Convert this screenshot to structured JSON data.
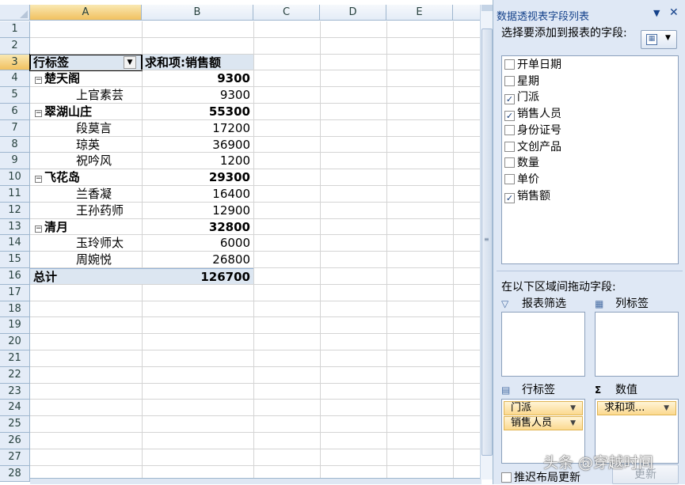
{
  "sheet": {
    "columns": [
      "A",
      "B",
      "C",
      "D",
      "E"
    ],
    "selected_column": "A",
    "rows": [
      "1",
      "2",
      "3",
      "4",
      "5",
      "6",
      "7",
      "8",
      "9",
      "10",
      "11",
      "12",
      "13",
      "14",
      "15",
      "16",
      "17",
      "18",
      "19",
      "20",
      "21",
      "22",
      "23",
      "24",
      "25",
      "26",
      "27",
      "28"
    ],
    "selected_row": "3"
  },
  "pivot": {
    "row_label_header": "行标签",
    "value_header": "求和项:销售额",
    "collapse_glyph": "⊟",
    "groups": [
      {
        "name": "楚天阁",
        "total": "9300",
        "items": [
          {
            "name": "上官素芸",
            "value": "9300"
          }
        ]
      },
      {
        "name": "翠湖山庄",
        "total": "55300",
        "items": [
          {
            "name": "段莫言",
            "value": "17200"
          },
          {
            "name": "琼英",
            "value": "36900"
          },
          {
            "name": "祝吟风",
            "value": "1200"
          }
        ]
      },
      {
        "name": "飞花岛",
        "total": "29300",
        "items": [
          {
            "name": "兰香凝",
            "value": "16400"
          },
          {
            "name": "王孙药师",
            "value": "12900"
          }
        ]
      },
      {
        "name": "清月",
        "total": "32800",
        "items": [
          {
            "name": "玉玲师太",
            "value": "6000"
          },
          {
            "name": "周婉悦",
            "value": "26800"
          }
        ]
      }
    ],
    "grand_total_label": "总计",
    "grand_total": "126700"
  },
  "field_list": {
    "title": "数据透视表字段列表",
    "choose_label": "选择要添加到报表的字段:",
    "fields": [
      {
        "label": "开单日期",
        "checked": false
      },
      {
        "label": "星期",
        "checked": false
      },
      {
        "label": "门派",
        "checked": true
      },
      {
        "label": "销售人员",
        "checked": true
      },
      {
        "label": "身份证号",
        "checked": false
      },
      {
        "label": "文创产品",
        "checked": false
      },
      {
        "label": "数量",
        "checked": false
      },
      {
        "label": "单价",
        "checked": false
      },
      {
        "label": "销售额",
        "checked": true
      }
    ],
    "drag_label": "在以下区域间拖动字段:",
    "zones": {
      "filter": "报表筛选",
      "columns": "列标签",
      "rows": "行标签",
      "values": "数值"
    },
    "row_chips": [
      "门派",
      "销售人员"
    ],
    "value_chips": [
      "求和项..."
    ],
    "defer_label": "推迟布局更新",
    "update_button": "更新"
  },
  "watermark": "头条 @穿越时间"
}
